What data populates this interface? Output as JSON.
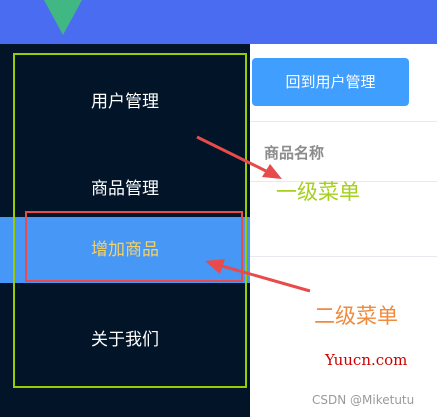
{
  "sidebar": {
    "items": [
      {
        "label": "用户管理"
      },
      {
        "label": "商品管理"
      },
      {
        "label": "关于我们"
      }
    ],
    "submenu": {
      "label": "增加商品"
    }
  },
  "main": {
    "back_button_label": "回到用户管理",
    "table": {
      "columns": [
        "商品名称"
      ]
    }
  },
  "annotations": {
    "level1": "一级菜单",
    "level2": "二级菜单"
  },
  "watermarks": {
    "site": "Yuucn.com",
    "credit": "CSDN @Miketutu"
  },
  "colors": {
    "header": "#4a6cf1",
    "sidebar_bg": "#011428",
    "active_bg": "#4797f7",
    "active_text": "#f6d163",
    "button": "#409eff"
  }
}
